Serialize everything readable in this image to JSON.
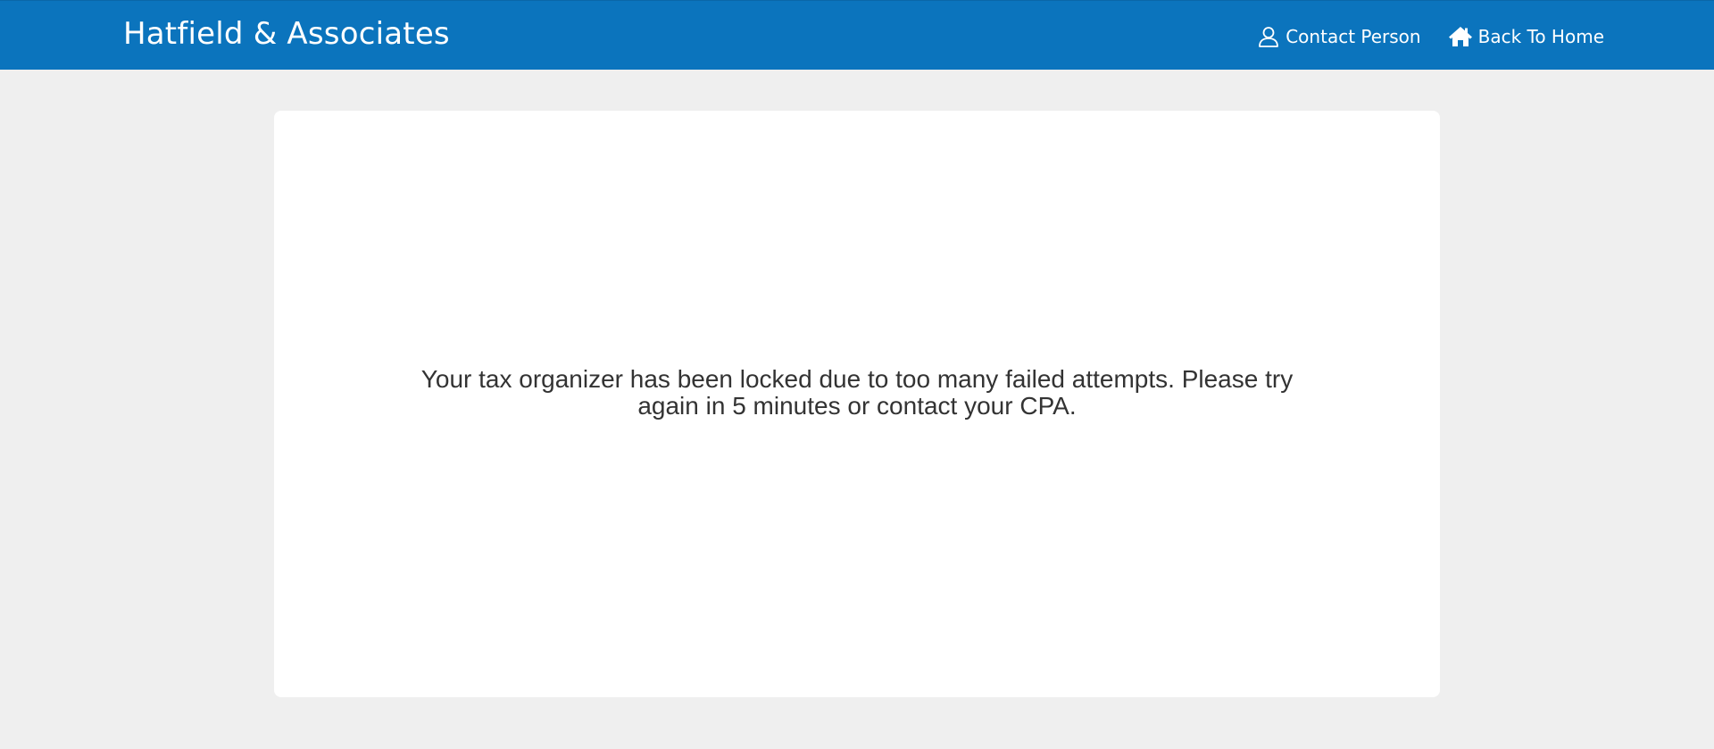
{
  "header": {
    "brand": "Hatfield & Associates",
    "background_color": "#0b74bd",
    "nav": {
      "contact": {
        "label": "Contact Person",
        "icon": "user-icon"
      },
      "home": {
        "label": "Back To Home",
        "icon": "home-icon"
      }
    }
  },
  "main": {
    "message": "Your tax organizer has been locked due to too many failed attempts. Please try again in 5 minutes or contact your CPA."
  }
}
